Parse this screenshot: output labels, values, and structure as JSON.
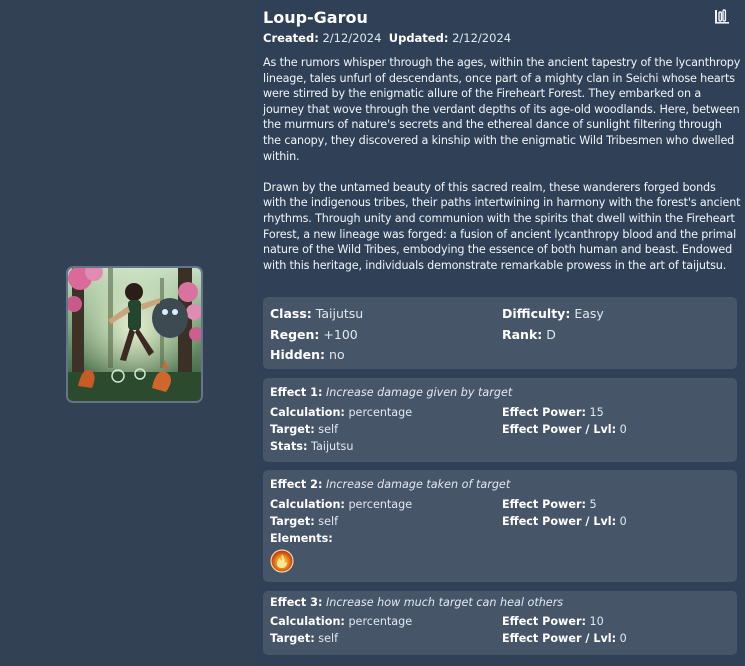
{
  "title": "Loup-Garou",
  "meta": {
    "created_label": "Created:",
    "created_value": "2/12/2024",
    "updated_label": "Updated:",
    "updated_value": "2/12/2024"
  },
  "description": [
    "As the rumors whisper through the ages, within the ancient tapestry of the lycanthropy lineage, tales unfurl of descendants, once part of a mighty clan in Seichi whose hearts were stirred by the enigmatic allure of the Fireheart Forest. They embarked on a journey that wove through the verdant depths of its age-old woodlands. Here, between the murmurs of nature's secrets and the ethereal dance of sunlight filtering through the canopy, they discovered a kinship with the enigmatic Wild Tribesmen who dwelled within.",
    "Drawn by the untamed beauty of this sacred realm, these wanderers forged bonds with the indigenous tribes, their paths intertwining in harmony with the forest's ancient rhythms. Through unity and communion with the spirits that dwell within the Fireheart Forest, a new lineage was forged: a fusion of ancient lycanthropy blood and the primal nature of the Wild Tribes, embodying the essence of both human and beast. Endowed with this heritage, individuals demonstrate remarkable prowess in the art of taijutsu."
  ],
  "info": {
    "class_label": "Class:",
    "class_value": "Taijutsu",
    "difficulty_label": "Difficulty:",
    "difficulty_value": "Easy",
    "regen_label": "Regen:",
    "regen_value": "+100",
    "rank_label": "Rank:",
    "rank_value": "D",
    "hidden_label": "Hidden:",
    "hidden_value": "no"
  },
  "effects": [
    {
      "title": "Effect 1:",
      "desc": "Increase damage given by target",
      "calculation_label": "Calculation:",
      "calculation_value": "percentage",
      "power_label": "Effect Power:",
      "power_value": "15",
      "target_label": "Target:",
      "target_value": "self",
      "power_lvl_label": "Effect Power / Lvl:",
      "power_lvl_value": "0",
      "stats_label": "Stats:",
      "stats_value": "Taijutsu"
    },
    {
      "title": "Effect 2:",
      "desc": "Increase damage taken of target",
      "calculation_label": "Calculation:",
      "calculation_value": "percentage",
      "power_label": "Effect Power:",
      "power_value": "5",
      "target_label": "Target:",
      "target_value": "self",
      "power_lvl_label": "Effect Power / Lvl:",
      "power_lvl_value": "0",
      "elements_label": "Elements:",
      "element_icon": "fire-element-icon"
    },
    {
      "title": "Effect 3:",
      "desc": "Increase how much target can heal others",
      "calculation_label": "Calculation:",
      "calculation_value": "percentage",
      "power_label": "Effect Power:",
      "power_value": "10",
      "target_label": "Target:",
      "target_value": "self",
      "power_lvl_label": "Effect Power / Lvl:",
      "power_lvl_value": "0"
    }
  ],
  "icons": {
    "stats": "bar-chart-icon"
  },
  "colors": {
    "page_bg": "#334155",
    "card_bg": "#475569",
    "text": "#f1f5f9"
  }
}
